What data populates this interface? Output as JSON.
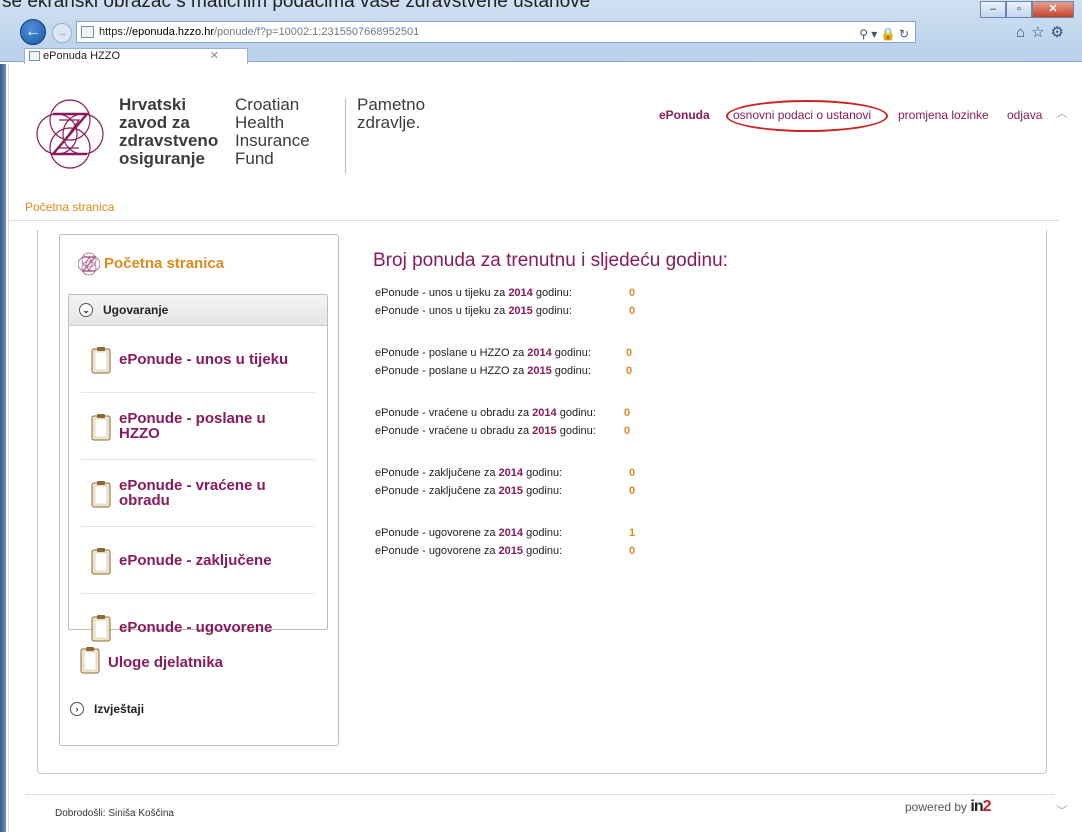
{
  "doc_caption": "se ekranski obrazac s matičnim podacima vaše zdravstvene ustanove",
  "browser": {
    "url_scheme": "https://",
    "url_host": "eponuda.hzzo.hr",
    "url_path": "/ponude/f?p=10002:1:2315507668952501",
    "tab_title": "ePonuda HZZO",
    "window_buttons": [
      "minimize-icon",
      "maximize-icon",
      "close-icon"
    ]
  },
  "header": {
    "org_hr": [
      "Hrvatski",
      "zavod za",
      "zdravstveno",
      "osiguranje"
    ],
    "org_en": [
      "Croatian",
      "Health",
      "Insurance",
      "Fund"
    ],
    "tagline": [
      "Pametno",
      "zdravlje."
    ],
    "nav": {
      "eponuda": "ePonuda",
      "basic_data": "osnovni podaci o ustanovi",
      "change_password": "promjena lozinke",
      "logout": "odjava"
    }
  },
  "breadcrumb": "Početna stranica",
  "sidebar": {
    "home": "Početna stranica",
    "group": "Ugovaranje",
    "items": [
      "ePonude - unos u tijeku",
      "ePonude - poslane u HZZO",
      "ePonude - vraćene u obradu",
      "ePonude - zaključene",
      "ePonude - ugovorene"
    ],
    "roles": "Uloge djelatnika",
    "reports": "Izvještaji"
  },
  "main": {
    "title": "Broj ponuda za trenutnu i sljedeću godinu:",
    "rows": [
      {
        "pre": "ePonude - unos u tijeku za ",
        "year": "2014",
        "post": " godinu:",
        "value": "0"
      },
      {
        "pre": "ePonude - unos u tijeku za ",
        "year": "2015",
        "post": " godinu:",
        "value": "0"
      },
      {
        "pre": "ePonude - poslane u HZZO za ",
        "year": "2014",
        "post": " godinu:",
        "value": "0"
      },
      {
        "pre": "ePonude - poslane u HZZO za ",
        "year": "2015",
        "post": " godinu:",
        "value": "0"
      },
      {
        "pre": "ePonude - vraćene u obradu za ",
        "year": "2014",
        "post": " godinu:",
        "value": "0"
      },
      {
        "pre": "ePonude - vraćene u obradu za ",
        "year": "2015",
        "post": " godinu:",
        "value": "0"
      },
      {
        "pre": "ePonude - zaključene za ",
        "year": "2014",
        "post": " godinu:",
        "value": "0"
      },
      {
        "pre": "ePonude - zaključene za ",
        "year": "2015",
        "post": " godinu:",
        "value": "0"
      },
      {
        "pre": "ePonude - ugovorene za ",
        "year": "2014",
        "post": " godinu:",
        "value": "1"
      },
      {
        "pre": "ePonude - ugovorene za ",
        "year": "2015",
        "post": " godinu:",
        "value": "0"
      }
    ]
  },
  "footer": {
    "welcome": "Dobrodošli: Siniša Koščina",
    "powered_by": "powered by",
    "brand_a": "in",
    "brand_b": "2"
  },
  "colors": {
    "brand_purple": "#8a1a5c",
    "accent_orange": "#e08a1e",
    "highlight_red": "#cc2222"
  }
}
